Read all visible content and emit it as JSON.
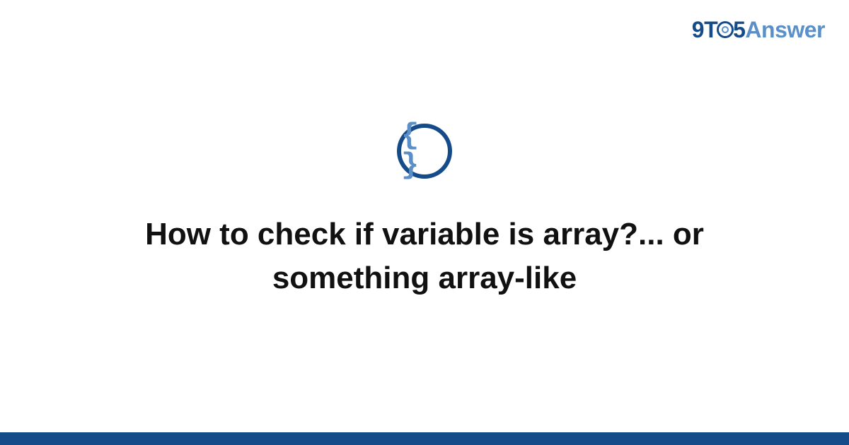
{
  "logo": {
    "part1": "9T",
    "part2": "5",
    "part3": "Answer"
  },
  "icon": {
    "name": "code-braces",
    "glyph": "{ }"
  },
  "title": "How to check if variable is array?... or something array-like",
  "colors": {
    "brand_dark": "#164b8a",
    "brand_light": "#5a8fc7"
  }
}
